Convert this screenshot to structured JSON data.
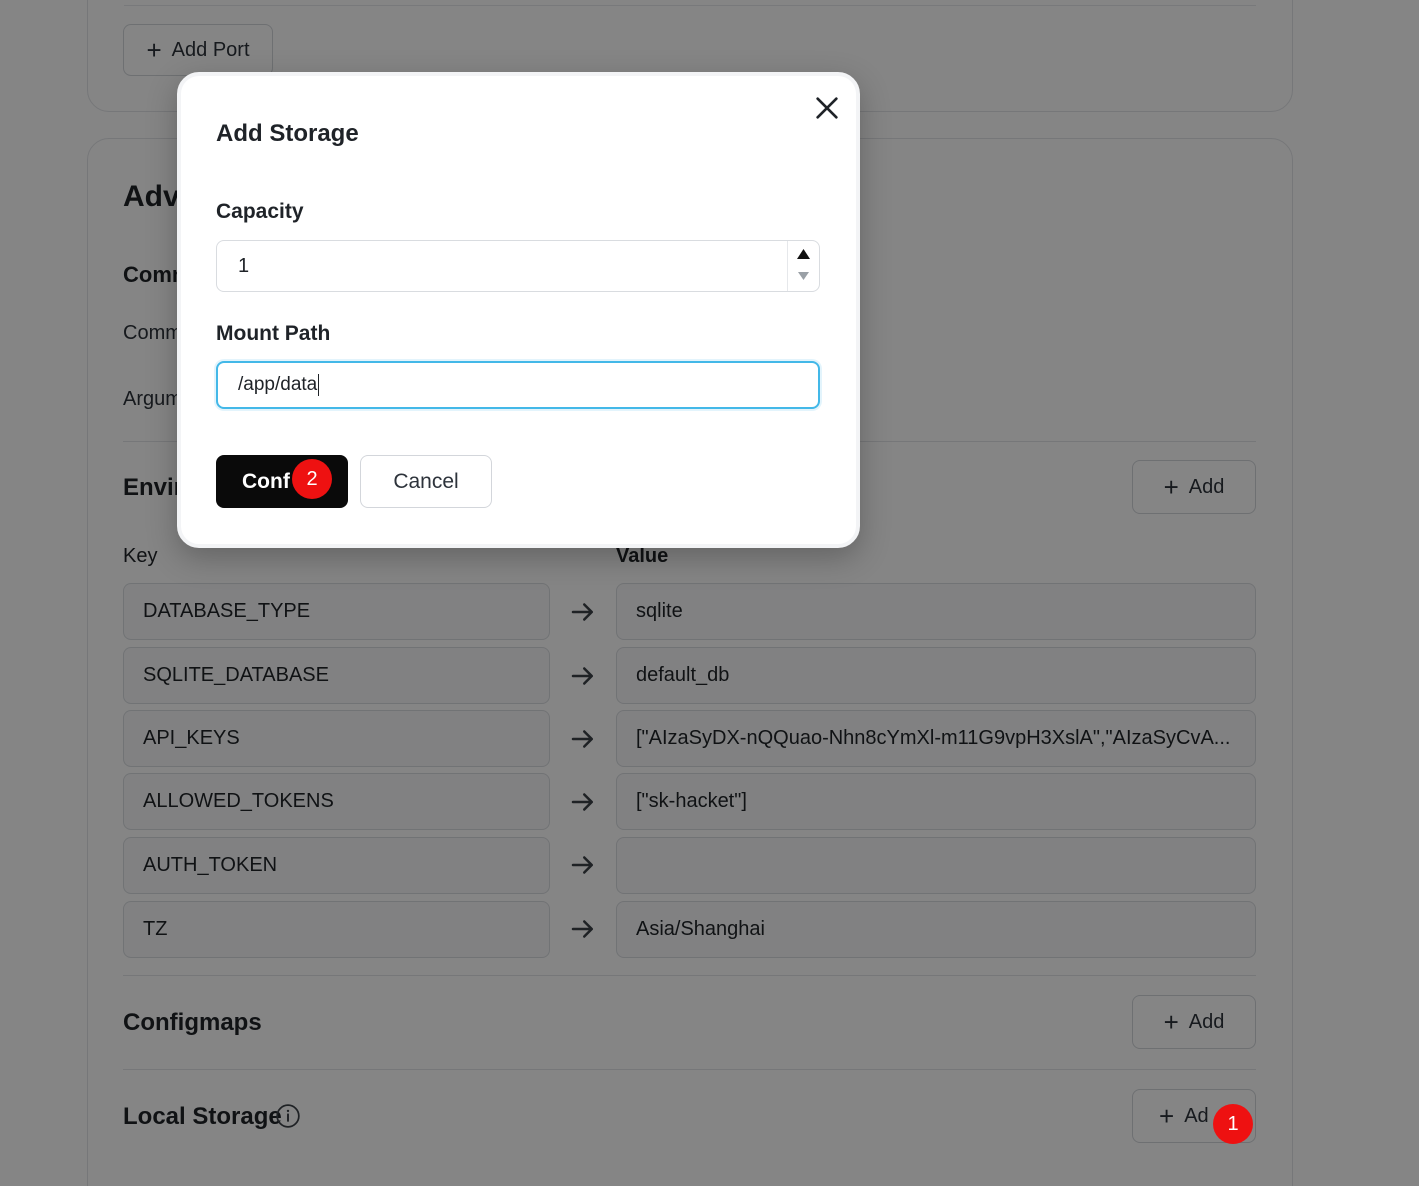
{
  "top_section": {
    "add_port_label": "Add Port"
  },
  "advanced": {
    "title": "Adv",
    "command_section": "Comm",
    "command_label": "Comm",
    "arguments_label": "Argum",
    "env_title": "Envir",
    "env_add_label": "Add",
    "key_header": "Key",
    "value_header": "Value",
    "env_rows": [
      {
        "key": "DATABASE_TYPE",
        "value": "sqlite"
      },
      {
        "key": "SQLITE_DATABASE",
        "value": "default_db"
      },
      {
        "key": "API_KEYS",
        "value": "[\"AIzaSyDX-nQQuao-Nhn8cYmXl-m11G9vpH3XslA\",\"AIzaSyCvA..."
      },
      {
        "key": "ALLOWED_TOKENS",
        "value": "[\"sk-hacket\"]"
      },
      {
        "key": "AUTH_TOKEN",
        "value": ""
      },
      {
        "key": "TZ",
        "value": "Asia/Shanghai"
      }
    ],
    "configmaps_title": "Configmaps",
    "configmaps_add_label": "Add",
    "local_storage_title": "Local Storage",
    "local_storage_add_label": "Ad"
  },
  "modal": {
    "title": "Add Storage",
    "capacity_label": "Capacity",
    "capacity_value": "1",
    "mount_path_label": "Mount Path",
    "mount_path_value": "/app/data",
    "confirm_label": "Conf",
    "cancel_label": "Cancel"
  },
  "badges": {
    "first": "1",
    "second": "2"
  },
  "colors": {
    "overlay": "#000000",
    "confirm_bg": "#0a0a0a",
    "focus_border": "#43b8e8",
    "badge": "#ee1111"
  }
}
